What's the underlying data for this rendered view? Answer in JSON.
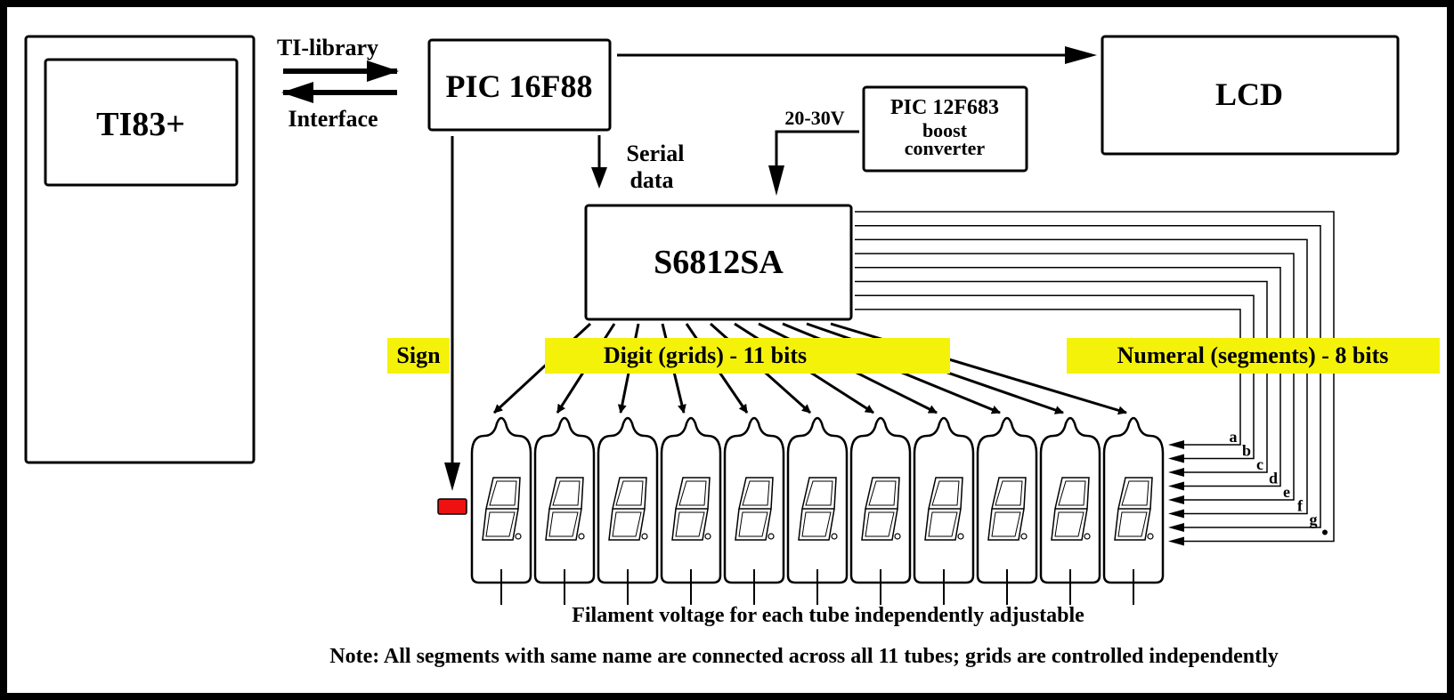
{
  "blocks": {
    "ti83": "TI83+",
    "pic16": "PIC 16F88",
    "lcd": "LCD",
    "pic12_line1": "PIC 12F683",
    "pic12_line2": "boost",
    "pic12_line3": "converter",
    "driver": "S6812SA"
  },
  "labels": {
    "ti_library": "TI-library",
    "interface": "Interface",
    "serial1": "Serial",
    "serial2": "data",
    "voltage": "20-30V",
    "sign": "Sign",
    "digit": "Digit (grids) -  11 bits",
    "numeral": "Numeral (segments) - 8 bits",
    "filament": "Filament voltage for each tube independently adjustable",
    "note": "Note: All segments with same name are connected across all 11 tubes; grids are controlled independently"
  },
  "segments": [
    "a",
    "b",
    "c",
    "d",
    "e",
    "f",
    "g"
  ],
  "tube_count": 11,
  "colors": {
    "highlight": "#f5f20a",
    "sign_led": "#ee1111",
    "border": "#000000"
  }
}
